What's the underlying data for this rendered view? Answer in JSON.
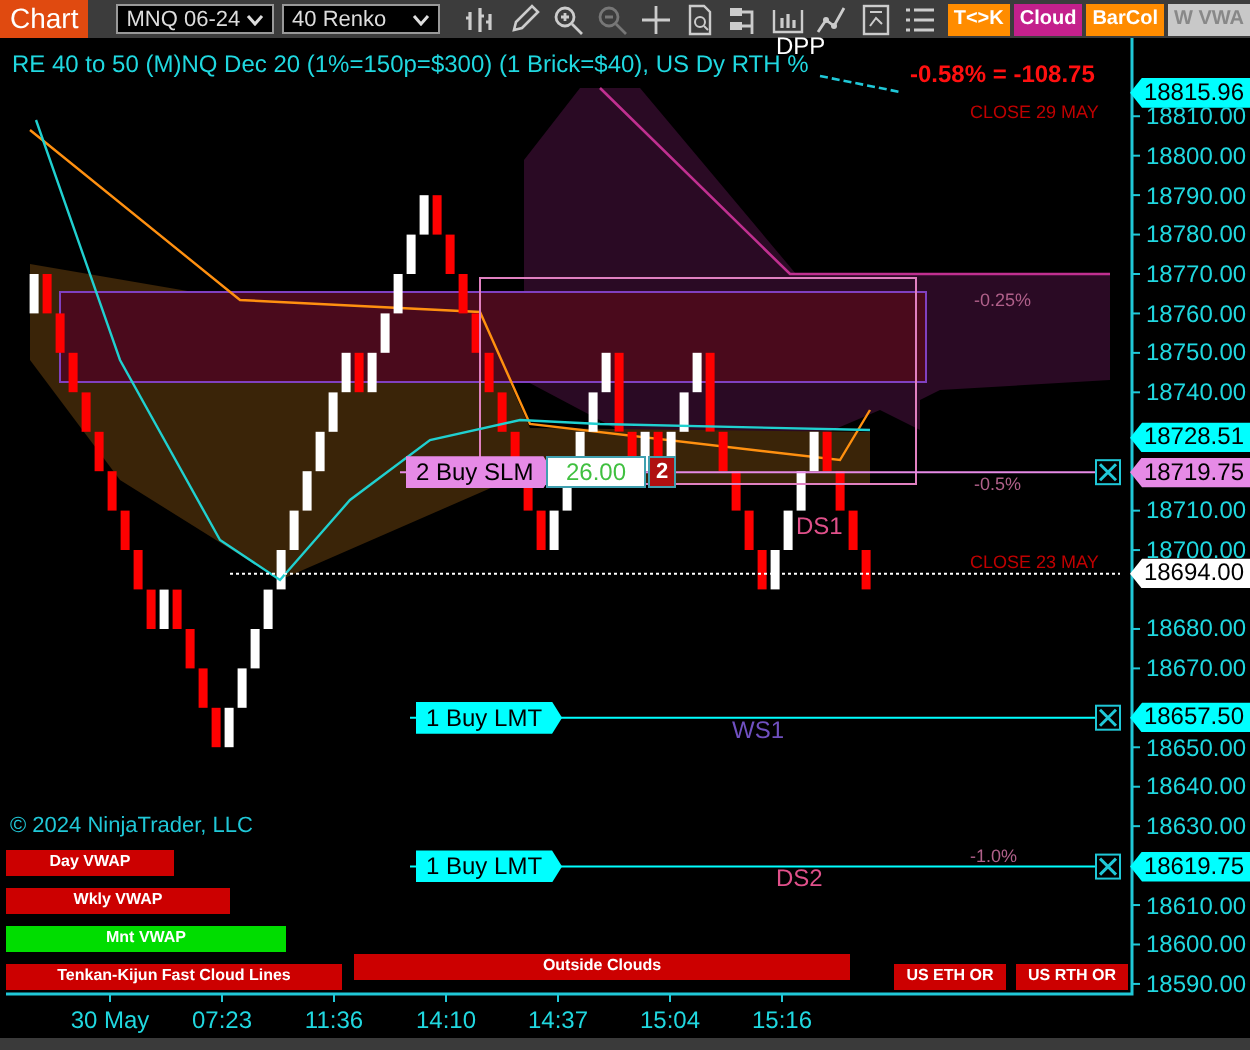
{
  "toolbar": {
    "title": "Chart",
    "instrument": "MNQ 06-24",
    "period": "40 Renko",
    "buttons": [
      {
        "label": "T<>K",
        "color": "#ff8c00"
      },
      {
        "label": "Cloud",
        "color": "#c4208c"
      },
      {
        "label": "BarCol",
        "color": "#ff8c00"
      },
      {
        "label": "W VWA",
        "color": "#c8c8c8"
      }
    ]
  },
  "chart": {
    "indicator_label": "RE 40 to 50 (M)NQ Dec 20 (1%=150p=$300) (1 Brick=$40), US Dy RTH %",
    "top_label": "DPP",
    "change": "-0.58% = -108.75",
    "levels": [
      {
        "text": "CLOSE 29 MAY",
        "color": "#c00000"
      },
      {
        "text": "-0.25%",
        "color": "#b0608a"
      },
      {
        "text": "-0.5%",
        "color": "#b0608a"
      },
      {
        "text": "DS1",
        "color": "#e0508a"
      },
      {
        "text": "CLOSE 23 MAY",
        "color": "#c00000"
      },
      {
        "text": "WS1",
        "color": "#7050c0"
      },
      {
        "text": "-1.0%",
        "color": "#b0608a"
      },
      {
        "text": "DS2",
        "color": "#e0508a"
      }
    ],
    "orders": [
      {
        "label": "2 Buy SLM",
        "color": "#e68ae6",
        "quantity": "26.00",
        "count": "2"
      },
      {
        "label": "1 Buy LMT",
        "color": "#00ffff"
      },
      {
        "label": "1 Buy LMT",
        "color": "#00ffff"
      }
    ],
    "status_bars": [
      {
        "label": "Day VWAP",
        "color": "#cc0000"
      },
      {
        "label": "Wkly VWAP",
        "color": "#cc0000"
      },
      {
        "label": "Mnt VWAP",
        "color": "#00dd00"
      },
      {
        "label": "Tenkan-Kijun Fast Cloud Lines",
        "color": "#cc0000"
      },
      {
        "label": "Outside Clouds",
        "color": "#cc0000"
      },
      {
        "label": "US ETH OR",
        "color": "#cc0000"
      },
      {
        "label": "US RTH OR",
        "color": "#cc0000"
      }
    ],
    "copyright": "© 2024 NinjaTrader, LLC"
  },
  "price_axis": {
    "ticks": [
      "18810.00",
      "18800.00",
      "18790.00",
      "18780.00",
      "18770.00",
      "18760.00",
      "18750.00",
      "18740.00",
      "18710.00",
      "18700.00",
      "18680.00",
      "18670.00",
      "18650.00",
      "18640.00",
      "18630.00",
      "18610.00",
      "18600.00",
      "18590.00"
    ],
    "markers": [
      {
        "price": "18815.96",
        "color": "#00ffff"
      },
      {
        "price": "18728.51",
        "color": "#00ffff"
      },
      {
        "price": "18719.75",
        "color": "#e68ae6"
      },
      {
        "price": "18694.00",
        "color": "#ffffff"
      },
      {
        "price": "18657.50",
        "color": "#00ffff"
      },
      {
        "price": "18619.75",
        "color": "#00ffff"
      }
    ]
  },
  "time_axis": {
    "labels": [
      "30 May",
      "07:23",
      "11:36",
      "14:10",
      "14:37",
      "15:04",
      "15:16"
    ]
  }
}
